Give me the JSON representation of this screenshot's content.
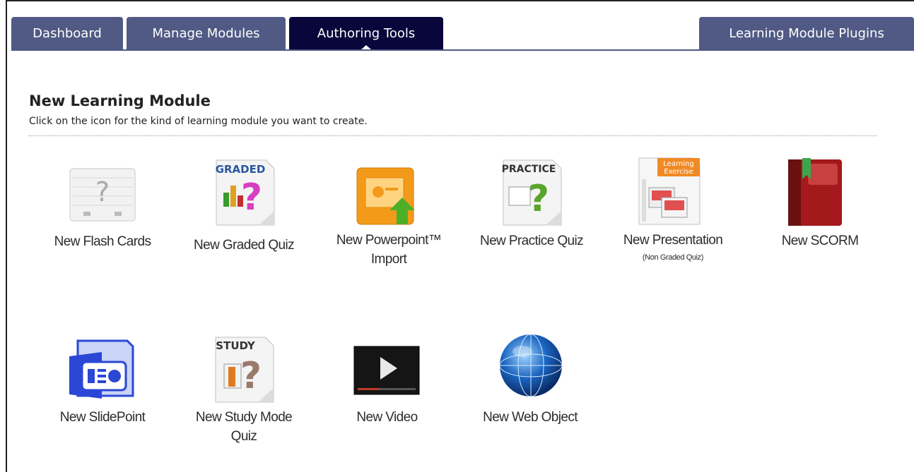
{
  "tabs": {
    "dashboard": "Dashboard",
    "manage_modules": "Manage Modules",
    "authoring_tools": "Authoring Tools",
    "plugins": "Learning Module Plugins"
  },
  "section": {
    "title": "New Learning Module",
    "subtitle": "Click on the icon for the kind of learning module you want to create."
  },
  "icon_text": {
    "graded": "GRADED",
    "practice": "PRACTICE",
    "study": "STUDY",
    "learning_exercise_1": "Learning",
    "learning_exercise_2": "Exercise",
    "question_mark": "?"
  },
  "modules": {
    "flash_cards": {
      "label": "New Flash Cards",
      "icon": "flash-cards-icon"
    },
    "graded_quiz": {
      "label": "New Graded Quiz",
      "icon": "graded-quiz-icon"
    },
    "powerpoint_import": {
      "label_line1": "New Powerpoint™",
      "label_line2": "Import",
      "icon": "powerpoint-import-icon"
    },
    "practice_quiz": {
      "label": "New Practice Quiz",
      "icon": "practice-quiz-icon"
    },
    "presentation": {
      "label": "New Presentation",
      "sublabel": "(Non Graded Quiz)",
      "icon": "presentation-icon"
    },
    "scorm": {
      "label": "New SCORM",
      "icon": "scorm-book-icon"
    },
    "slidepoint": {
      "label": "New SlidePoint",
      "icon": "slidepoint-icon"
    },
    "study_quiz": {
      "label_line1": "New Study Mode",
      "label_line2": "Quiz",
      "icon": "study-quiz-icon"
    },
    "video": {
      "label": "New Video",
      "icon": "video-play-icon"
    },
    "web_object": {
      "label": "New Web Object",
      "icon": "globe-icon"
    }
  },
  "colors": {
    "tab_bg": "#505a84",
    "tab_active_bg": "#08063a",
    "powerpoint_orange": "#f39a1a",
    "scorm_red": "#a3191c",
    "slidepoint_blue": "#2b47d6",
    "globe_blue": "#1a64c0"
  }
}
